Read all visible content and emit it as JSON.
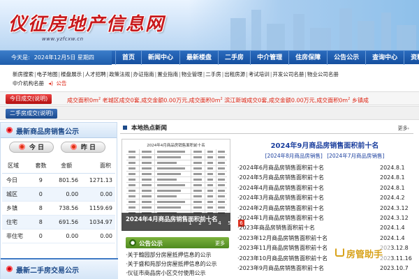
{
  "header": {
    "site_title": "仪征房地产信息网",
    "site_url": "www.yzfcxw.cn"
  },
  "navbar": {
    "today_label": "今天是:",
    "today_date": "2024年12月5日 星期四",
    "links": [
      "首页",
      "新闻中心",
      "最新楼盘",
      "二手房",
      "中介管理",
      "住房保障",
      "公告公示",
      "查询中心",
      "资料下载"
    ]
  },
  "sublinks": {
    "row1": [
      "新房搜索",
      "电子地图",
      "楼盘展示",
      "人才招聘",
      "政策法规",
      "办证指南",
      "置业指南",
      "物业管理",
      "二手房",
      "出租房源",
      "考试培训",
      "开发公司名册",
      "物业公司名册"
    ],
    "row2": [
      "中介机构名册"
    ],
    "notice": "公告"
  },
  "ticker1": {
    "label": "今日成交(说明)",
    "text_a": "成交面积0m",
    "text_b": "  老城区成交0套,成交金额0.00万元,成交面积0m",
    "text_c": "  滨江新城成交0套,成交金额0.00万元,成交面积0m",
    "text_d": "  乡镇成",
    "sup": "2"
  },
  "ticker2": {
    "label": "二手房成交(说明)"
  },
  "sales": {
    "title": "最新商品房销售公示",
    "today_btn": "今 日",
    "yesterday_btn": "昨 日",
    "headers": [
      "区域",
      "套数",
      "金额",
      "面积"
    ],
    "rows": [
      [
        "今日",
        "9",
        "801.56",
        "1271.13"
      ],
      [
        "城区",
        "0",
        "0.00",
        "0.00"
      ],
      [
        "乡镇",
        "8",
        "738.56",
        "1159.69"
      ],
      [
        "住宅",
        "8",
        "691.56",
        "1034.97"
      ],
      [
        "非住宅",
        "0",
        "0.00",
        "0.00"
      ]
    ]
  },
  "second_hand": {
    "title": "最新二手房交易公示"
  },
  "news": {
    "title": "本地热点新闻",
    "more": "更多",
    "mock_title": "2024年4月商品房销售面积前十名",
    "caption": "2024年4月商品房销售面积前十名",
    "pages": [
      "1",
      "2",
      "3",
      "4",
      "5",
      "6"
    ],
    "active_page": "6"
  },
  "notices": {
    "title": "公告公示",
    "more": "更多",
    "items": [
      "·关于翰园部分房屋抵押信息的公示",
      "·关于盛和苑部分房屋抵押信息的公示",
      "·仪征市商品房小区交付使用公示"
    ]
  },
  "headline": {
    "title": "2024年9月商品房销售面积前十名",
    "link1": "[2024年8月商品房销售]",
    "link2": "[2024年7月商品房销售]"
  },
  "articles": [
    {
      "title": "·2024年6月商品房销售面积前十名",
      "date": "2024.8.1"
    },
    {
      "title": "·2024年5月商品房销售面积前十名",
      "date": "2024.8.1"
    },
    {
      "title": "·2024年4月商品房销售面积前十名",
      "date": "2024.8.1"
    },
    {
      "title": "·2024年3月商品房销售面积前十名",
      "date": "2024.4.2"
    },
    {
      "title": "·2024年2月商品房销售面积前十名",
      "date": "2024.3.12"
    },
    {
      "title": "·2024年1月商品房销售面积前十名",
      "date": "2024.3.12"
    },
    {
      "title": "·2023年商品房销售面积前十名",
      "date": "2024.1.4"
    },
    {
      "title": "·2023年12月商品房销售面积前十名",
      "date": "2024.1.4"
    },
    {
      "title": "·2023年11月商品房销售面积前十名",
      "date": "2023.12.8"
    },
    {
      "title": "·2023年10月商品房销售面积前十名",
      "date": "2023.11.16"
    },
    {
      "title": "·2023年9月商品房销售面积前十名",
      "date": "2023.10.7"
    }
  ],
  "watermark": {
    "text": "房管助手"
  }
}
